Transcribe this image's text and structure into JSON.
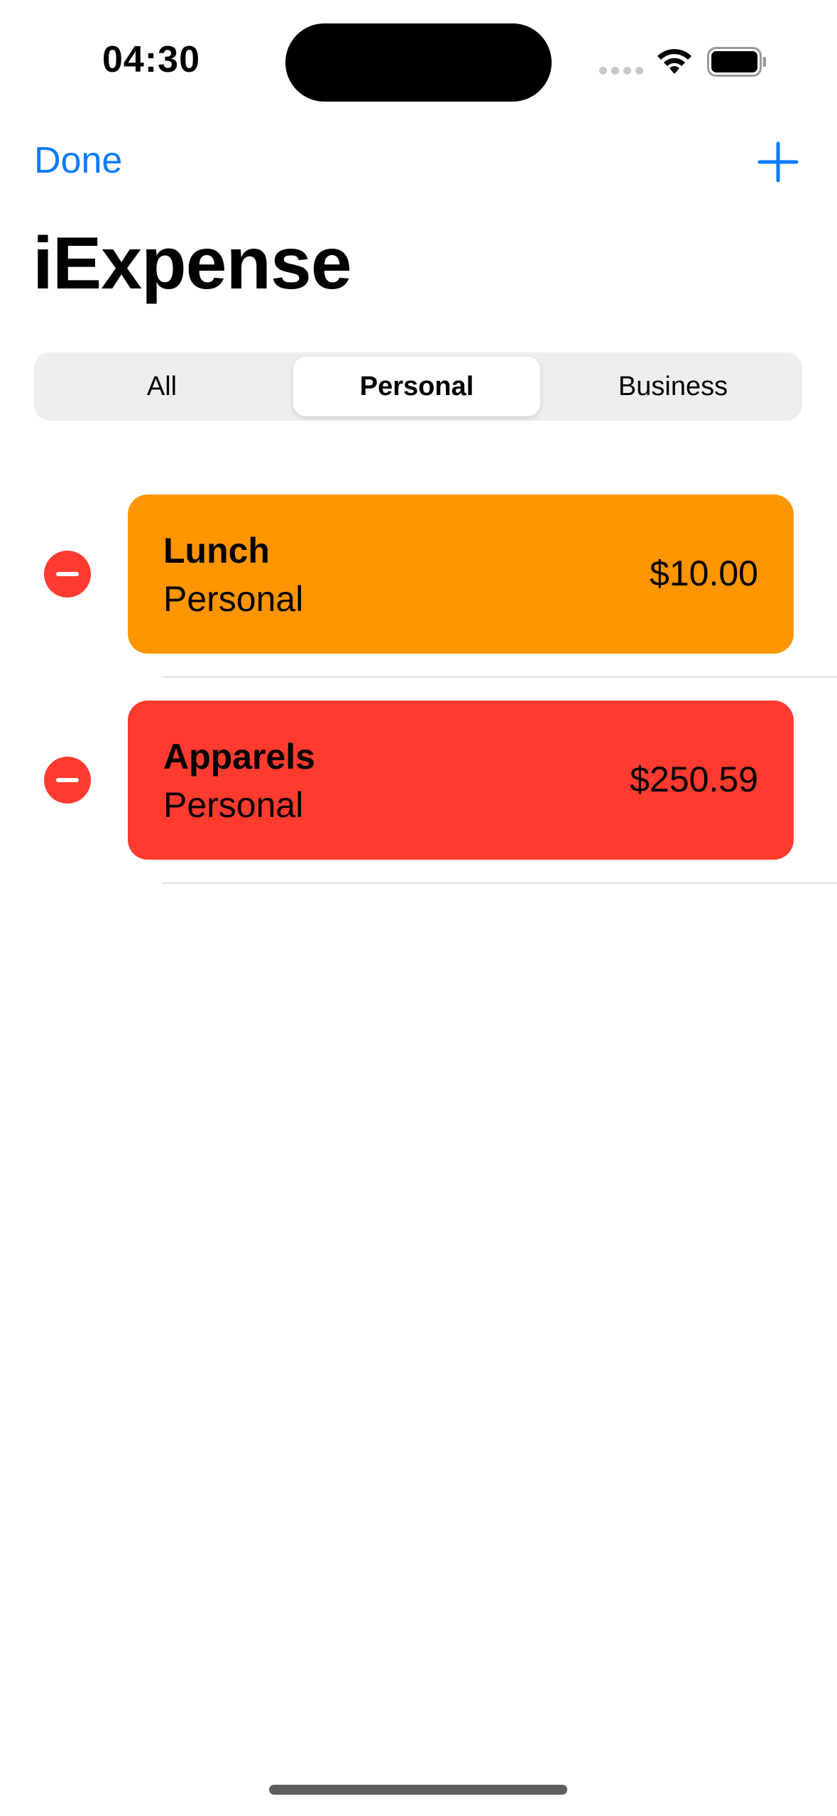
{
  "status_bar": {
    "time": "04:30",
    "icons": [
      "cellular-icon",
      "wifi-icon",
      "battery-icon"
    ]
  },
  "nav": {
    "done_label": "Done",
    "add_icon": "plus-icon",
    "accent_color": "#0a7aff"
  },
  "title": "iExpense",
  "segments": {
    "items": [
      "All",
      "Personal",
      "Business"
    ],
    "selected": "Personal"
  },
  "expenses": [
    {
      "name": "Lunch",
      "type": "Personal",
      "amount": "$10.00",
      "color": "#ff9500"
    },
    {
      "name": "Apparels",
      "type": "Personal",
      "amount": "$250.59",
      "color": "#ff3b30"
    }
  ],
  "delete_color": "#ff3b30"
}
